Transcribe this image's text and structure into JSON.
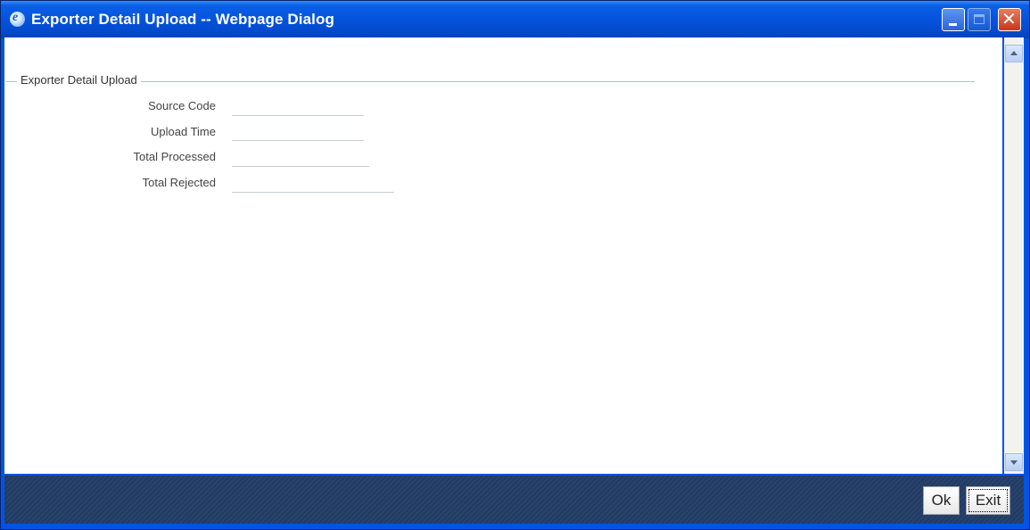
{
  "window": {
    "title": "Exporter Detail Upload -- Webpage Dialog",
    "icon": "ie-icon",
    "controls": [
      "minimize-icon",
      "maximize-icon",
      "close-icon"
    ]
  },
  "section": {
    "title": "Exporter Detail Upload"
  },
  "fields": {
    "source_code": {
      "label": "Source Code",
      "value": ""
    },
    "upload_time": {
      "label": "Upload Time",
      "value": ""
    },
    "total_processed": {
      "label": "Total Processed",
      "value": ""
    },
    "total_rejected": {
      "label": "Total Rejected",
      "value": ""
    }
  },
  "buttons": {
    "ok": "Ok",
    "exit": "Exit"
  },
  "colors": {
    "titlebar": "#0553dc",
    "footer": "#213b64",
    "section_line": "#a7c1d8"
  }
}
